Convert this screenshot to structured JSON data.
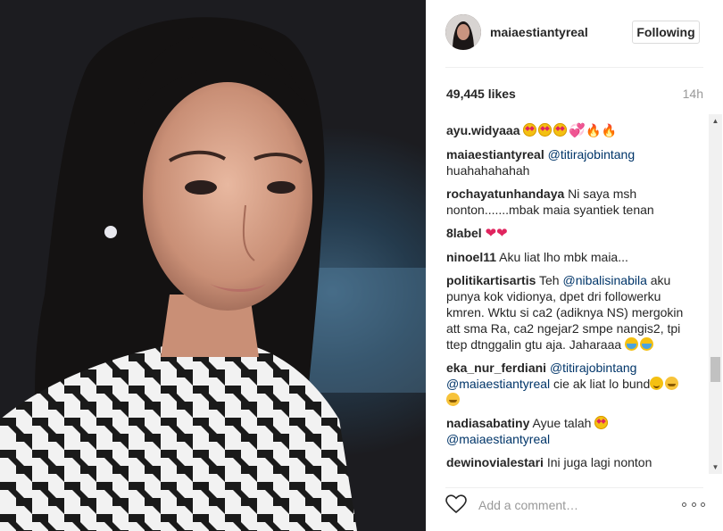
{
  "post": {
    "username": "maiaestiantyreal",
    "follow_label": "Following",
    "likes": "49,445 likes",
    "time": "14h"
  },
  "comments": [
    {
      "user": "ayu.widyaaa",
      "parts": [
        {
          "t": "emoji",
          "v": "hearteyes"
        },
        {
          "t": "emoji",
          "v": "hearteyes"
        },
        {
          "t": "emoji",
          "v": "hearteyes"
        },
        {
          "t": "glyph",
          "v": "💞",
          "c": "heart-pink"
        },
        {
          "t": "glyph",
          "v": "🔥",
          "c": "fire"
        },
        {
          "t": "glyph",
          "v": "🔥",
          "c": "fire"
        }
      ]
    },
    {
      "user": "maiaestiantyreal",
      "parts": [
        {
          "t": "mention",
          "v": "@titirajobintang"
        },
        {
          "t": "text",
          "v": " huahahahahah"
        }
      ]
    },
    {
      "user": "rochayatunhandaya",
      "parts": [
        {
          "t": "text",
          "v": "Ni saya msh nonton.......mbak maia syantiek tenan"
        }
      ]
    },
    {
      "user": "8label",
      "parts": [
        {
          "t": "glyph",
          "v": "❤",
          "c": "heart-red"
        },
        {
          "t": "glyph",
          "v": "❤",
          "c": "heart-red"
        }
      ]
    },
    {
      "user": "ninoel11",
      "parts": [
        {
          "t": "text",
          "v": "Aku liat lho mbk maia..."
        }
      ]
    },
    {
      "user": "politikartisartis",
      "parts": [
        {
          "t": "text",
          "v": "Teh "
        },
        {
          "t": "mention",
          "v": "@nibalisinabila"
        },
        {
          "t": "text",
          "v": " aku punya kok vidionya, dpet dri followerku kmren. Wktu si ca2 (adiknya NS) mergokin att sma Ra, ca2 ngejar2 smpe nangis2, tpi ttep dtnggalin gtu aja. Jaharaaa "
        },
        {
          "t": "emoji",
          "v": "sob"
        },
        {
          "t": "emoji",
          "v": "sob"
        }
      ]
    },
    {
      "user": "eka_nur_ferdiani",
      "parts": [
        {
          "t": "mention",
          "v": "@titirajobintang"
        },
        {
          "t": "text",
          "v": " "
        },
        {
          "t": "mention",
          "v": "@maiaestiantyreal"
        },
        {
          "t": "text",
          "v": " cie ak liat lo bund"
        },
        {
          "t": "emoji",
          "v": "blush"
        },
        {
          "t": "emoji",
          "v": "grin"
        },
        {
          "t": "emoji",
          "v": "grin"
        }
      ]
    },
    {
      "user": "nadiasabatiny",
      "parts": [
        {
          "t": "text",
          "v": "Ayue talah "
        },
        {
          "t": "emoji",
          "v": "hearteyes"
        },
        {
          "t": "text",
          "v": " "
        },
        {
          "t": "mention",
          "v": "@maiaestiantyreal"
        }
      ]
    },
    {
      "user": "dewinovialestari",
      "parts": [
        {
          "t": "text",
          "v": "Ini juga lagi nonton"
        }
      ]
    }
  ],
  "footer": {
    "comment_placeholder": "Add a comment…"
  },
  "icons": {
    "like": "heart-outline-icon",
    "more": "more-options-icon",
    "scroll_up": "scroll-up-arrow-icon",
    "scroll_down": "scroll-down-arrow-icon"
  },
  "colors": {
    "mention": "#003569",
    "follow_border": "#dbdbdb",
    "muted": "#999999"
  }
}
